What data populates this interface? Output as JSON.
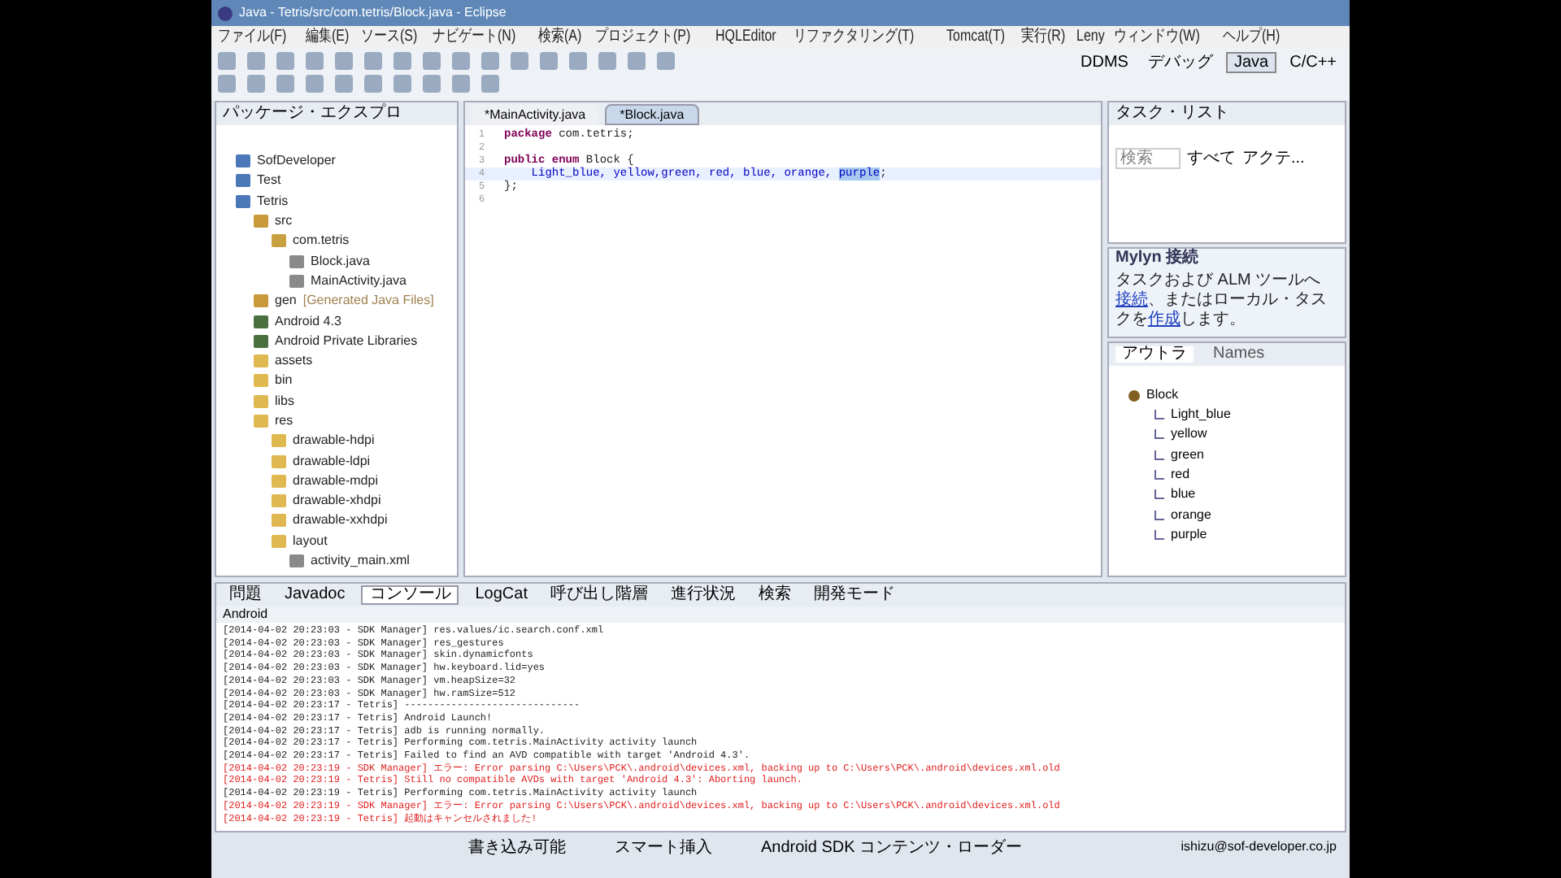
{
  "window": {
    "title": "Java - Tetris/src/com.tetris/Block.java - Eclipse"
  },
  "menu": [
    "ファイル(F)",
    "編集(E)",
    "ソース(S)",
    "ナビゲート(N)",
    "検索(A)",
    "プロジェクト(P)",
    "HQLEditor",
    "リファクタリング(T)",
    "Tomcat(T)",
    "実行(R)",
    "Leny",
    "ウィンドウ(W)",
    "ヘルプ(H)"
  ],
  "perspectives": [
    {
      "label": "DDMS",
      "selected": false
    },
    {
      "label": "デバッグ",
      "selected": false
    },
    {
      "label": "Java",
      "selected": true
    },
    {
      "label": "C/C++",
      "selected": false
    }
  ],
  "package_explorer": {
    "title": "パッケージ・エクスプロ",
    "tree": [
      {
        "label": "SofDeveloper",
        "kind": "project"
      },
      {
        "label": "Test",
        "kind": "project"
      },
      {
        "label": "Tetris",
        "kind": "project",
        "children": [
          {
            "label": "src",
            "kind": "source",
            "children": [
              {
                "label": "com.tetris",
                "kind": "package",
                "children": [
                  {
                    "label": "Block.java",
                    "kind": "file"
                  },
                  {
                    "label": "MainActivity.java",
                    "kind": "file"
                  }
                ]
              }
            ]
          },
          {
            "label": "gen",
            "note": "[Generated Java Files]",
            "kind": "source"
          },
          {
            "label": "Android 4.3",
            "kind": "library"
          },
          {
            "label": "Android Private Libraries",
            "kind": "library"
          },
          {
            "label": "assets",
            "kind": "folder"
          },
          {
            "label": "bin",
            "kind": "folder"
          },
          {
            "label": "libs",
            "kind": "folder"
          },
          {
            "label": "res",
            "kind": "folder",
            "children": [
              {
                "label": "drawable-hdpi",
                "kind": "folder"
              },
              {
                "label": "drawable-ldpi",
                "kind": "folder"
              },
              {
                "label": "drawable-mdpi",
                "kind": "folder"
              },
              {
                "label": "drawable-xhdpi",
                "kind": "folder"
              },
              {
                "label": "drawable-xxhdpi",
                "kind": "folder"
              },
              {
                "label": "layout",
                "kind": "folder",
                "children": [
                  {
                    "label": "activity_main.xml",
                    "kind": "file"
                  }
                ]
              }
            ]
          }
        ]
      }
    ]
  },
  "editor": {
    "tabs": [
      {
        "label": "*MainActivity.java",
        "selected": false
      },
      {
        "label": "*Block.java",
        "selected": true
      }
    ],
    "lines": [
      {
        "number": "1",
        "current": false,
        "segments": [
          {
            "text": "package",
            "kind": "keyword"
          },
          {
            "text": " com.tetris;",
            "kind": "plain"
          }
        ]
      },
      {
        "number": "2",
        "current": false
      },
      {
        "number": "3",
        "current": false,
        "segments": [
          {
            "text": "public enum",
            "kind": "keyword"
          },
          {
            "text": " Block {",
            "kind": "plain"
          }
        ]
      },
      {
        "number": "4",
        "current": true,
        "segments": [
          {
            "text": "    Light_blue, yellow,green, red, blue, orange, ",
            "kind": "field"
          },
          {
            "text": "purple",
            "kind": "selected"
          },
          {
            "text": ";",
            "kind": "plain"
          }
        ]
      },
      {
        "number": "5",
        "current": false,
        "segments": [
          {
            "text": "};",
            "kind": "plain"
          }
        ]
      },
      {
        "number": "6",
        "current": false
      }
    ]
  },
  "task_list": {
    "title": "タスク・リスト",
    "search": {
      "placeholder": "検索"
    },
    "filters": [
      "すべて",
      "アクテ..."
    ]
  },
  "mylyn": {
    "title": "Mylyn 接続",
    "parts": [
      {
        "text": "タスクおよび ALM ツールへ",
        "link": false
      },
      {
        "text": "接続",
        "link": true
      },
      {
        "text": "、またはローカル・タスクを",
        "link": false
      },
      {
        "text": "作成",
        "link": true
      },
      {
        "text": "します。",
        "link": false
      }
    ]
  },
  "outline": {
    "tabs": [
      {
        "label": "アウトラ",
        "selected": true
      },
      {
        "label": "Names",
        "selected": false
      }
    ],
    "root": "Block",
    "items": [
      "Light_blue",
      "yellow",
      "green",
      "red",
      "blue",
      "orange",
      "purple"
    ]
  },
  "console": {
    "tabs": [
      {
        "label": "問題",
        "selected": false
      },
      {
        "label": "Javadoc",
        "selected": false
      },
      {
        "label": "コンソール",
        "selected": true
      },
      {
        "label": "LogCat",
        "selected": false
      },
      {
        "label": "呼び出し階層",
        "selected": false
      },
      {
        "label": "進行状況",
        "selected": false
      },
      {
        "label": "検索",
        "selected": false
      },
      {
        "label": "開発モード",
        "selected": false
      }
    ],
    "name": "Android",
    "lines": [
      {
        "text": "[2014-04-02 20:23:03 - SDK Manager] res.values/ic.search.conf.xml",
        "kind": "info"
      },
      {
        "text": "[2014-04-02 20:23:03 - SDK Manager] res_gestures",
        "kind": "info"
      },
      {
        "text": "[2014-04-02 20:23:03 - SDK Manager] skin.dynamicfonts",
        "kind": "info"
      },
      {
        "text": "[2014-04-02 20:23:03 - SDK Manager] hw.keyboard.lid=yes",
        "kind": "info"
      },
      {
        "text": "[2014-04-02 20:23:03 - SDK Manager] vm.heapSize=32",
        "kind": "info"
      },
      {
        "text": "[2014-04-02 20:23:03 - SDK Manager] hw.ramSize=512",
        "kind": "info"
      },
      {
        "text": "[2014-04-02 20:23:17 - Tetris] ------------------------------",
        "kind": "info"
      },
      {
        "text": "[2014-04-02 20:23:17 - Tetris] Android Launch!",
        "kind": "info"
      },
      {
        "text": "[2014-04-02 20:23:17 - Tetris] adb is running normally.",
        "kind": "info"
      },
      {
        "text": "[2014-04-02 20:23:17 - Tetris] Performing com.tetris.MainActivity activity launch",
        "kind": "info"
      },
      {
        "text": "[2014-04-02 20:23:17 - Tetris] Failed to find an AVD compatible with target 'Android 4.3'.",
        "kind": "info"
      },
      {
        "text": "[2014-04-02 20:23:19 - SDK Manager] エラー: Error parsing C:\\Users\\PCK\\.android\\devices.xml, backing up to C:\\Users\\PCK\\.android\\devices.xml.old",
        "kind": "error"
      },
      {
        "text": "[2014-04-02 20:23:19 - Tetris] Still no compatible AVDs with target 'Android 4.3': Aborting launch.",
        "kind": "error"
      },
      {
        "text": "[2014-04-02 20:23:19 - Tetris] Performing com.tetris.MainActivity activity launch",
        "kind": "info"
      },
      {
        "text": "[2014-04-02 20:23:19 - SDK Manager] エラー: Error parsing C:\\Users\\PCK\\.android\\devices.xml, backing up to C:\\Users\\PCK\\.android\\devices.xml.old",
        "kind": "error"
      },
      {
        "text": "[2014-04-02 20:23:19 - Tetris] 起動はキャンセルされました!",
        "kind": "error"
      }
    ]
  },
  "status_bar": {
    "fields": [
      "書き込み可能",
      "スマート挿入",
      "Android SDK コンテンツ・ローダー"
    ],
    "user": "ishizu@sof-developer.co.jp"
  }
}
